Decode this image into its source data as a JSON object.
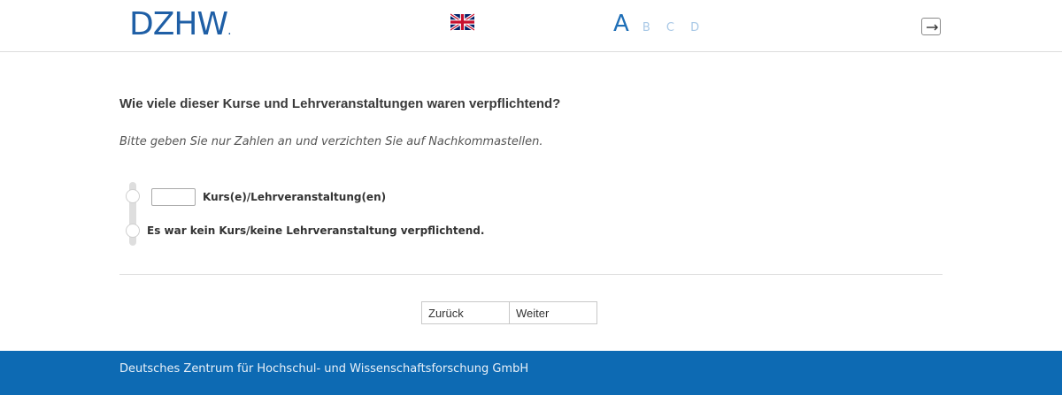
{
  "header": {
    "logo_text": "DZHW",
    "logo_dot": ".",
    "language_icon": "uk-flag-icon",
    "levels": [
      "A",
      "B",
      "C",
      "D"
    ],
    "active_level": "A",
    "exit_icon": "exit-icon"
  },
  "question": {
    "title": "Wie viele dieser Kurse und Lehrveranstaltungen waren verpflichtend?",
    "instruction": "Bitte geben Sie nur Zahlen an und verzichten Sie auf Nachkommastellen.",
    "options": [
      {
        "input_value": "",
        "label": "Kurs(e)/Lehrveranstaltung(en)"
      },
      {
        "label": "Es war kein Kurs/keine Lehrveranstaltung verpflichtend."
      }
    ]
  },
  "navigation": {
    "back_label": "Zurück",
    "next_label": "Weiter"
  },
  "footer": {
    "text": "Deutsches Zentrum für Hochschul- und Wissenschaftsforschung GmbH"
  },
  "colors": {
    "brand_blue": "#1f5fa6",
    "footer_blue": "#0d6ab3",
    "level_active": "#1f6fb7",
    "level_inactive": "#a8c8e6"
  }
}
